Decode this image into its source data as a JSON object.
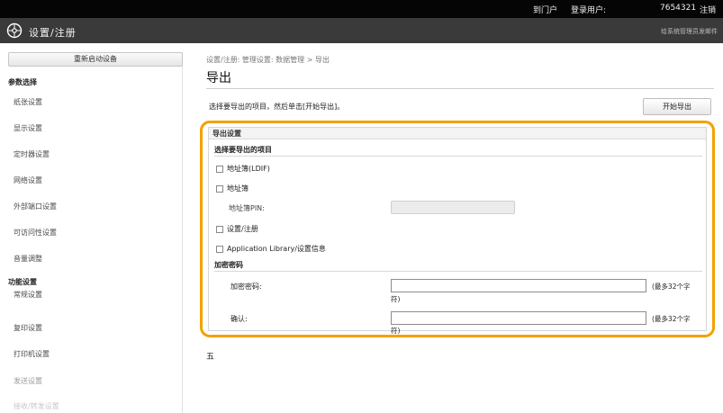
{
  "topbar": {
    "path_text": "",
    "portal_label": "到门户",
    "login_user_label": "登录用户:",
    "login_user_id": "7654321",
    "logout_label": "注销"
  },
  "header": {
    "title": "设置/注册",
    "mail_link": "给系统管理员发邮件"
  },
  "sidebar": {
    "top_button": "重新启动设备",
    "sections": [
      {
        "label": "参数选择"
      },
      {
        "label": "功能设置"
      }
    ],
    "pref_items": [
      "纸张设置",
      "显示设置",
      "定时器设置",
      "网络设置",
      "外部端口设置",
      "可访问性设置",
      "音量调整"
    ],
    "func_items": [
      "常规设置",
      "复印设置",
      "打印机设置",
      "发送设置",
      "接收/转发设置"
    ]
  },
  "main": {
    "breadcrumb": "设置/注册: 管理设置: 数据管理 > 导出",
    "title": "导出",
    "instruction": "选择要导出的项目，然后单击[开始导出]。",
    "start_button": "开始导出"
  },
  "panel": {
    "header": "导出设置",
    "select_section": "选择要导出的项目",
    "items": [
      {
        "label": "地址簿(LDIF)",
        "checked": false
      },
      {
        "label": "地址簿",
        "checked": false
      },
      {
        "label": "设置/注册",
        "checked": false
      },
      {
        "label": "Application Library/设置信息",
        "checked": false
      }
    ],
    "pin_label": "地址簿PIN:",
    "pin_value": "",
    "encrypt_section": "加密密码",
    "password_label": "加密密码:",
    "password_value": "",
    "confirm_label": "确认:",
    "confirm_value": "",
    "max_hint_line1": "(最多32个字",
    "max_hint_line2": "符)"
  },
  "footnote": "五"
}
